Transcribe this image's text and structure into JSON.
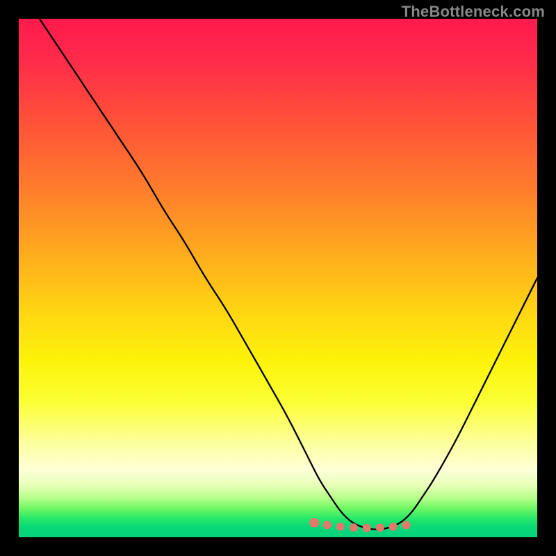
{
  "watermark": "TheBottleneck.com",
  "chart_data": {
    "type": "line",
    "title": "",
    "xlabel": "",
    "ylabel": "",
    "xlim": [
      0,
      100
    ],
    "ylim": [
      0,
      100
    ],
    "series": [
      {
        "name": "bottleneck-curve",
        "x": [
          4,
          8,
          12,
          16,
          20,
          24,
          28,
          32,
          36,
          40,
          44,
          48,
          52,
          56,
          58,
          60,
          62,
          64,
          66,
          68,
          70,
          72,
          74,
          76,
          78,
          80,
          84,
          88,
          92,
          96,
          100
        ],
        "y": [
          100,
          94,
          88,
          82,
          76,
          70,
          63,
          57,
          50,
          44,
          37,
          30,
          23,
          15,
          11,
          8,
          5,
          3,
          2,
          1.5,
          1.5,
          2,
          3,
          5,
          8,
          11,
          18,
          26,
          34,
          42,
          50
        ]
      }
    ],
    "highlight": {
      "name": "optimal-range-marker",
      "x_range": [
        57,
        76
      ],
      "y": 2,
      "color": "#e4786c"
    },
    "background": {
      "type": "vertical-gradient",
      "stops": [
        {
          "pos": 0.0,
          "color": "#ff1a4d"
        },
        {
          "pos": 0.32,
          "color": "#ff7a2c"
        },
        {
          "pos": 0.66,
          "color": "#fcf30a"
        },
        {
          "pos": 0.9,
          "color": "#e8ffb8"
        },
        {
          "pos": 1.0,
          "color": "#06d37a"
        }
      ]
    }
  }
}
